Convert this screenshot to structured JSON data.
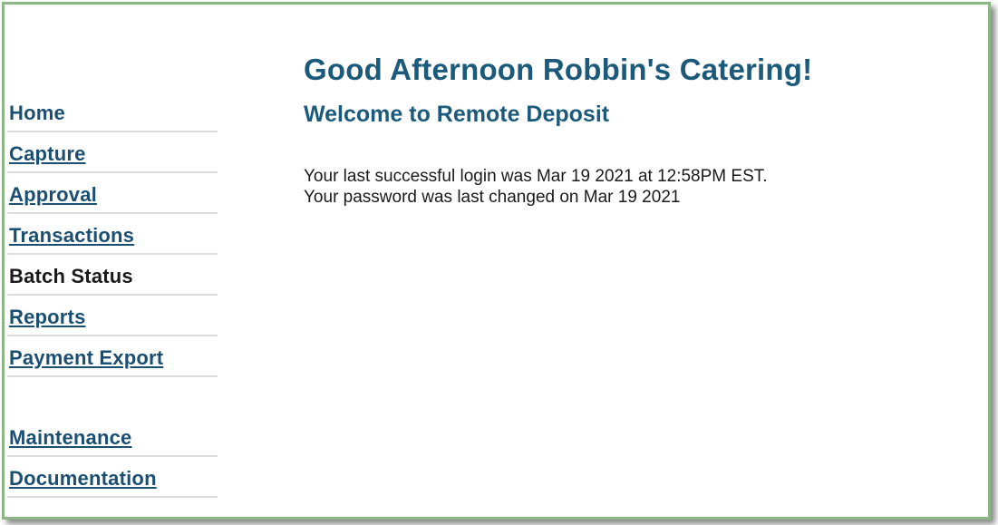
{
  "header": {
    "greeting": "Good Afternoon Robbin's Catering!",
    "subtitle": "Welcome to Remote Deposit"
  },
  "sidebar": {
    "items": [
      {
        "label": "Home",
        "state": "plain"
      },
      {
        "label": "Capture",
        "state": "link"
      },
      {
        "label": "Approval",
        "state": "link"
      },
      {
        "label": "Transactions",
        "state": "link"
      },
      {
        "label": "Batch Status",
        "state": "current"
      },
      {
        "label": "Reports",
        "state": "link"
      },
      {
        "label": "Payment Export",
        "state": "link"
      },
      {
        "label": "Maintenance",
        "state": "link"
      },
      {
        "label": "Documentation",
        "state": "link"
      }
    ]
  },
  "main": {
    "last_login": "Your last successful login was Mar 19 2021 at 12:58PM EST.",
    "password_changed": "Your password was last changed on Mar 19 2021"
  },
  "colors": {
    "frame_border": "#8cb686",
    "link": "#1b4f72",
    "heading": "#1b5a7a",
    "text": "#1a1a1a"
  }
}
